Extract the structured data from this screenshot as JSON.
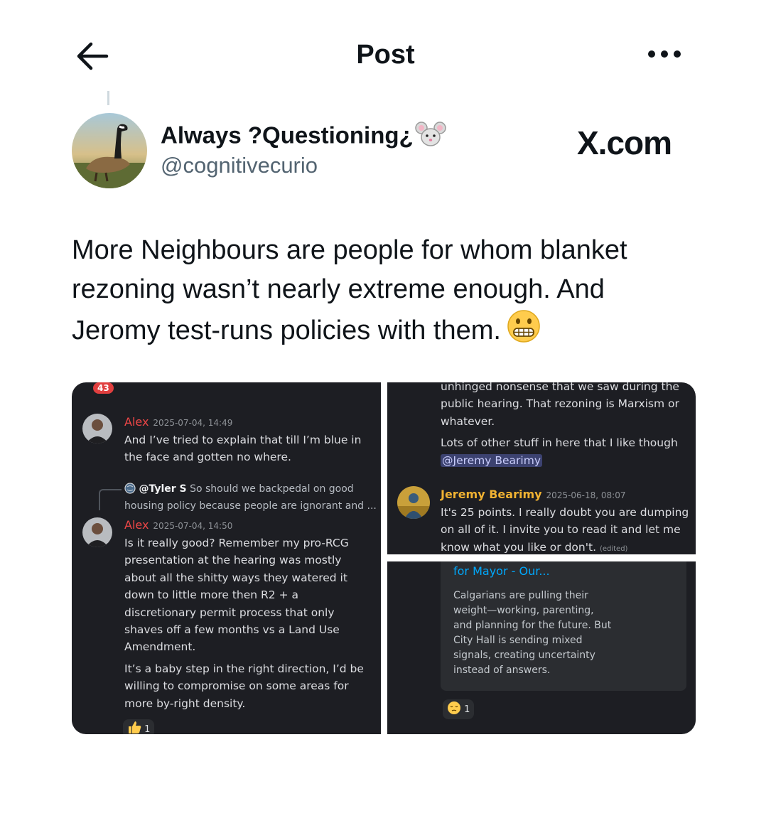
{
  "header": {
    "title": "Post",
    "back_icon": "arrow-left-icon",
    "more_icon": "more-dots-icon"
  },
  "author": {
    "display_name": "Always ?Questioning¿",
    "name_emoji": "mouse-face-icon",
    "handle": "@cognitivecurio"
  },
  "watermark": "X.com",
  "post": {
    "lines": [
      "More Neighbours are people for whom blanket",
      "rezoning wasn’t nearly extreme enough. And",
      "Jeromy test-runs policies with them."
    ],
    "emoji": "grimacing-face-icon"
  },
  "screenshots": {
    "left": {
      "unread_count": "43",
      "messages": [
        {
          "author": "Alex",
          "timestamp": "2025-07-04, 14:49",
          "lines": [
            "And I’ve tried to explain that till I’m blue in",
            "the face and gotten no where."
          ]
        },
        {
          "reply_author": "@Tyler S",
          "reply_preview_1": "So should we backpedal on good",
          "reply_preview_2": "housing policy because people are ignorant and ...",
          "author": "Alex",
          "timestamp": "2025-07-04, 14:50",
          "lines": [
            "Is it really good? Remember my pro-RCG",
            "presentation at the hearing was mostly",
            "about all the shitty ways they watered it",
            "down to little more then R2 + a",
            "discretionary permit process that only",
            "shaves off a few months vs a Land Use",
            "Amendment."
          ],
          "lines2": [
            "It’s a baby step in the right direction, I’d be",
            "willing to compromise on some areas for",
            "more by-right density."
          ],
          "reaction_count": "1"
        }
      ]
    },
    "top_right": {
      "lines": [
        "unhinged nonsense that we saw during the",
        "public hearing. That rezoning is Marxism or",
        "whatever."
      ],
      "line_after": "Lots of other stuff in here that I like though",
      "mention": "@Jeremy Bearimy",
      "message": {
        "author": "Jeremy Bearimy",
        "timestamp": "2025-06-18, 08:07",
        "lines": [
          "It's 25 points. I really doubt you are dumping",
          "on all of it. I invite you to read it and let me",
          "know what you like or don't."
        ],
        "edited": "(edited)"
      }
    },
    "bottom_right": {
      "embed_title": "for Mayor - Our...",
      "embed_lines": [
        "Calgarians are pulling their",
        "weight—working, parenting,",
        "and planning for the future. But",
        "City Hall is sending mixed",
        "signals, creating uncertainty",
        "instead of answers."
      ],
      "reaction_count": "1"
    }
  }
}
